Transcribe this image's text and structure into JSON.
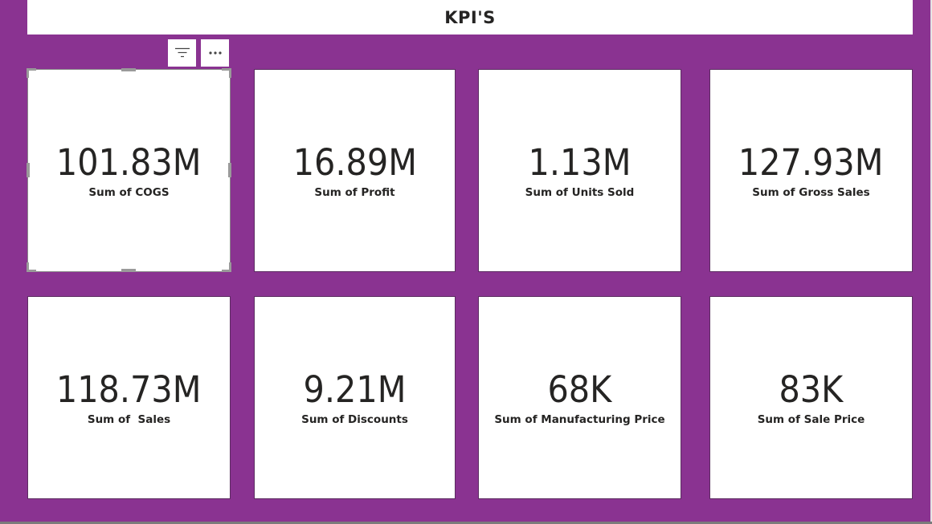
{
  "page": {
    "title": "KPI'S"
  },
  "visual_header": {
    "filter_icon": "filter-icon",
    "more_icon": "more-options-icon"
  },
  "cards": [
    {
      "value": "101.83M",
      "label": "Sum of COGS"
    },
    {
      "value": "16.89M",
      "label": "Sum of Profit"
    },
    {
      "value": "1.13M",
      "label": "Sum of Units Sold"
    },
    {
      "value": "127.93M",
      "label": "Sum of Gross Sales"
    },
    {
      "value": "118.73M",
      "label": "Sum of  Sales"
    },
    {
      "value": "9.21M",
      "label": "Sum of Discounts"
    },
    {
      "value": "68K",
      "label": "Sum of Manufacturing Price"
    },
    {
      "value": "83K",
      "label": "Sum of Sale Price"
    }
  ],
  "colors": {
    "background": "#8a3391",
    "card": "#ffffff",
    "text": "#252423"
  }
}
